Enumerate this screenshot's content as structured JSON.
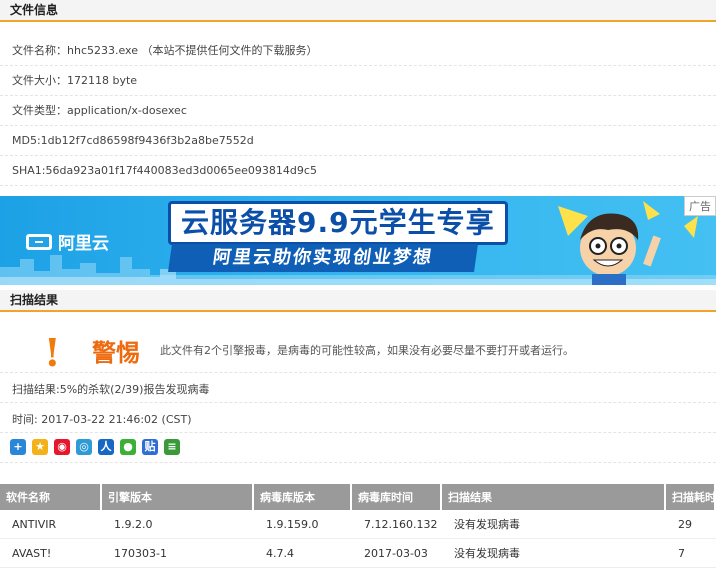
{
  "file_info": {
    "heading": "文件信息",
    "name_label": "文件名称：",
    "name_value": "hhc5233.exe （本站不提供任何文件的下载服务）",
    "size_label": "文件大小：",
    "size_value": "172118 byte",
    "type_label": "文件类型：",
    "type_value": "application/x-dosexec",
    "md5_label": "MD5:",
    "md5_value": "1db12f7cd86598f9436f3b2a8be7552d",
    "sha1_label": "SHA1:",
    "sha1_value": "56da923a01f17f440083ed3d0065ee093814d9c5"
  },
  "banner": {
    "logo_text": "阿里云",
    "title": "云服务器9.9元学生专享",
    "subtitle": "阿里云助你实现创业梦想",
    "ad_label": "广告",
    "colors": {
      "bg": "#2fb0ec",
      "title": "#0b4fa8",
      "sub_bg": "#0f5fb7"
    }
  },
  "scan": {
    "heading": "扫描结果",
    "warning_mark": "!",
    "warning_title": "警惕",
    "warning_text": "此文件有2个引擎报毒，是病毒的可能性较高，如果没有必要尽量不要打开或者运行。",
    "result_line": "扫描结果:5%的杀软(2/39)报告发现病毒",
    "time_line": "时间: 2017-03-22 21:46:02 (CST)",
    "share_icons": [
      "share-plus-icon",
      "qzone-icon",
      "weibo-icon",
      "tencent-weibo-icon",
      "renren-icon",
      "wechat-icon",
      "tieba-icon",
      "douban-icon"
    ]
  },
  "table": {
    "headers": [
      "软件名称",
      "引擎版本",
      "病毒库版本",
      "病毒库时间",
      "扫描结果",
      "扫描耗时"
    ],
    "rows": [
      [
        "ANTIVIR",
        "1.9.2.0",
        "1.9.159.0",
        "7.12.160.132",
        "没有发现病毒",
        "29"
      ],
      [
        "AVAST!",
        "170303-1",
        "4.7.4",
        "2017-03-03",
        "没有发现病毒",
        "7"
      ]
    ]
  }
}
